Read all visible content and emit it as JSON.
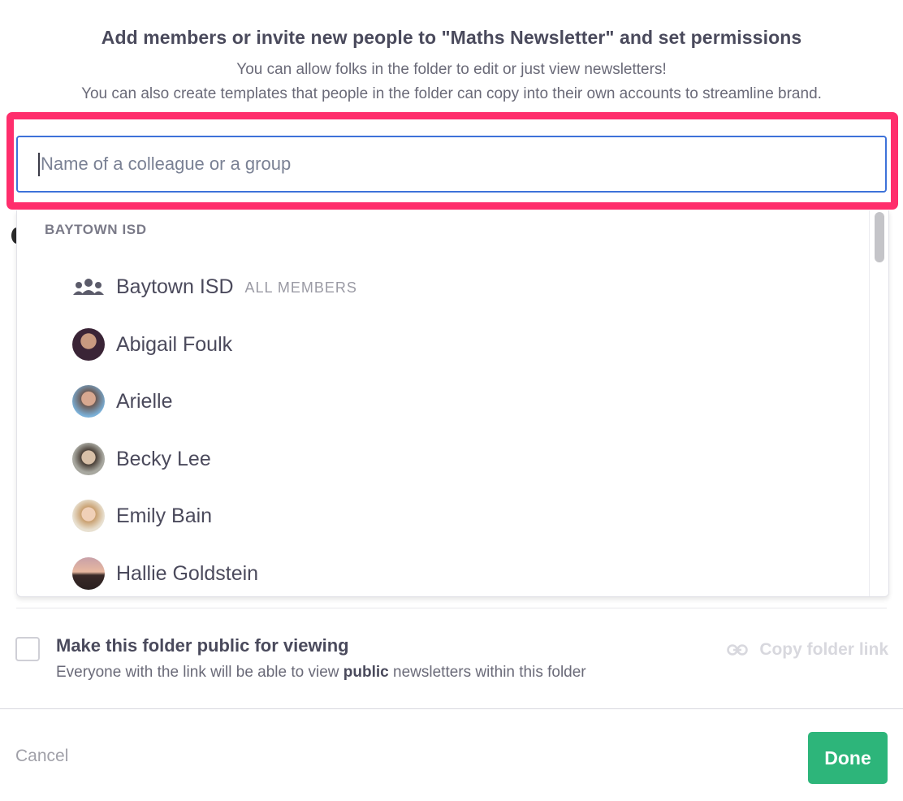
{
  "dialog": {
    "title": "Add members or invite new people to \"Maths Newsletter\" and set permissions",
    "subtitle_line1": "You can allow folks in the folder to edit or just view newsletters!",
    "subtitle_line2": "You can also create templates that people in the folder can copy into their own accounts to streamline brand."
  },
  "search": {
    "placeholder": "Name of a colleague or a group",
    "value": ""
  },
  "dropdown": {
    "group_header": "BAYTOWN ISD",
    "group_item": {
      "name": "Baytown ISD",
      "tag": "ALL MEMBERS",
      "icon": "group-icon"
    },
    "people": [
      {
        "name": "Abigail Foulk",
        "avatar_color": "#3a2436"
      },
      {
        "name": "Arielle",
        "avatar_color": "#6b5a55"
      },
      {
        "name": "Becky Lee",
        "avatar_color": "#7d7a70"
      },
      {
        "name": "Emily Bain",
        "avatar_color": "#c9b49a"
      },
      {
        "name": "Hallie Goldstein",
        "avatar_color": "#5a4038"
      }
    ]
  },
  "public_option": {
    "label": "Make this folder public for viewing",
    "desc_prefix": "Everyone with the link will be able to view ",
    "desc_bold": "public",
    "desc_suffix": " newsletters within this folder",
    "checked": false
  },
  "copy_link": {
    "label": "Copy folder link",
    "icon": "link-icon"
  },
  "footer": {
    "cancel_label": "Cancel",
    "done_label": "Done"
  },
  "colors": {
    "highlight": "#ff2e6c",
    "done": "#2db57a",
    "focus": "#3d72d9"
  }
}
